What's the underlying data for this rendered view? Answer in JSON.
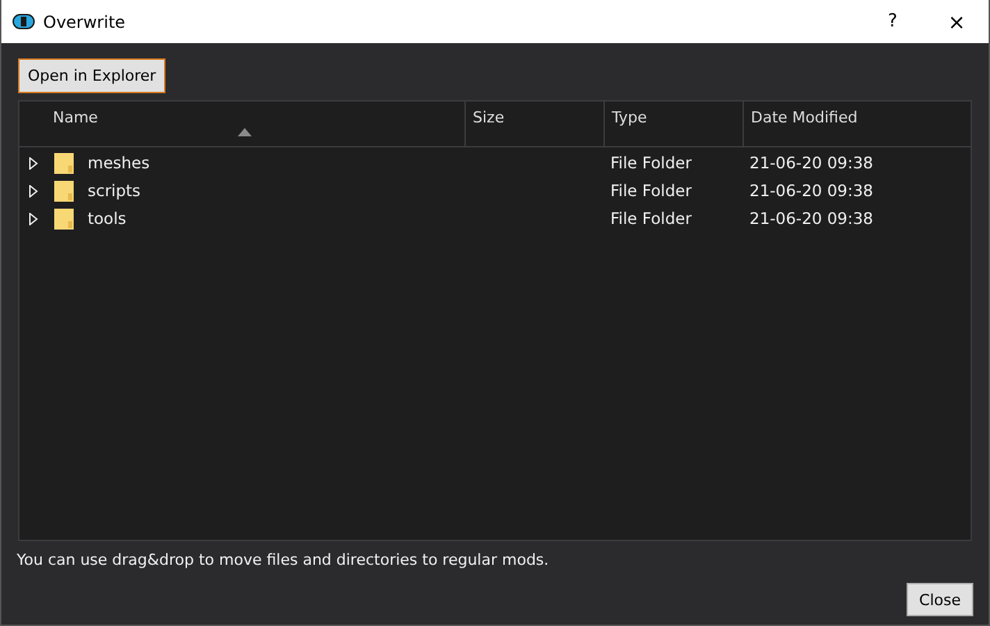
{
  "window": {
    "title": "Overwrite",
    "buttons": [
      "?",
      "×"
    ]
  },
  "open_button": "Open in Explorer",
  "table": {
    "columns": [
      {
        "label": "Name",
        "sorted": true
      },
      {
        "label": "Size",
        "sorted": false
      },
      {
        "label": "Type",
        "sorted": false
      },
      {
        "label": "Date Modified",
        "sorted": false
      }
    ],
    "rows": [
      {
        "name": "meshes",
        "expanded": false,
        "type": "File Folder",
        "modified": "21-06-20 09:38"
      },
      {
        "name": "scripts",
        "expanded": false,
        "type": "File Folder",
        "modified": "21-06-20 09:38"
      },
      {
        "name": "tools",
        "expanded": false,
        "type": "File Folder",
        "modified": "21-06-20 09:38"
      }
    ]
  },
  "hint": "You can use drag&drop to move files and directories to regular mods.",
  "close_button": "Close"
}
